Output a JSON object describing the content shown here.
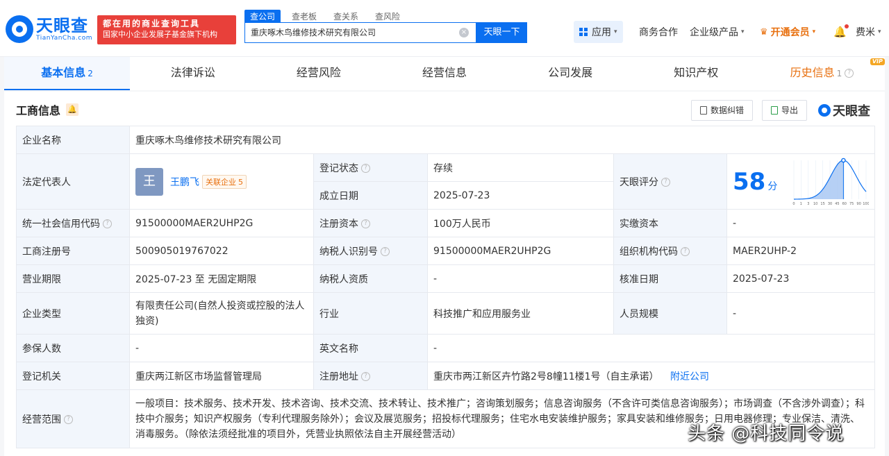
{
  "brand": {
    "name_cn": "天眼查",
    "name_en": "TianYanCha.com"
  },
  "slogan": {
    "line1": "都在用的商业查询工具",
    "line2": "国家中小企业发展子基金旗下机构"
  },
  "search": {
    "tabs": [
      "查公司",
      "查老板",
      "查关系",
      "查风险"
    ],
    "value": "重庆啄木鸟维修技术研究有限公司",
    "button": "天眼一下",
    "clear": "×"
  },
  "nav": {
    "apps": "应用",
    "business": "商务合作",
    "enterprise": "企业级产品",
    "vip": "开通会员",
    "user": "费米",
    "caret": "▾",
    "crown": "♛",
    "bell": "🔔"
  },
  "tabs": [
    {
      "label": "基本信息",
      "count": "2"
    },
    {
      "label": "法律诉讼"
    },
    {
      "label": "经营风险"
    },
    {
      "label": "经营信息"
    },
    {
      "label": "公司发展"
    },
    {
      "label": "知识产权"
    },
    {
      "label": "历史信息",
      "count": "1",
      "badge": "VIP"
    }
  ],
  "section": {
    "title": "工商信息",
    "bell": "🔔",
    "btn_correct": "数据纠错",
    "btn_export": "导出",
    "brand": "天眼查"
  },
  "info": {
    "company_name_label": "企业名称",
    "company_name": "重庆啄木鸟维修技术研究有限公司",
    "legal_rep_label": "法定代表人",
    "avatar": "王",
    "legal_rep": "王鹏飞",
    "assoc_label": "关联企业",
    "assoc_count": "5",
    "reg_status_label": "登记状态",
    "reg_status": "存续",
    "found_date_label": "成立日期",
    "found_date": "2025-07-23",
    "score_label": "天眼评分",
    "score": "58",
    "score_unit": "分",
    "credit_code_label": "统一社会信用代码",
    "credit_code": "91500000MAER2UHP2G",
    "reg_capital_label": "注册资本",
    "reg_capital": "100万人民币",
    "paid_capital_label": "实缴资本",
    "paid_capital": "-",
    "reg_no_label": "工商注册号",
    "reg_no": "500905019767022",
    "taxpayer_id_label": "纳税人识别号",
    "taxpayer_id": "91500000MAER2UHP2G",
    "org_code_label": "组织机构代码",
    "org_code": "MAER2UHP-2",
    "term_label": "营业期限",
    "term": "2025-07-23 至 无固定期限",
    "taxpayer_qual_label": "纳税人资质",
    "taxpayer_qual": "-",
    "approve_date_label": "核准日期",
    "approve_date": "2025-07-23",
    "type_label": "企业类型",
    "type": "有限责任公司(自然人投资或控股的法人独资)",
    "industry_label": "行业",
    "industry": "科技推广和应用服务业",
    "staff_label": "人员规模",
    "staff": "-",
    "insured_label": "参保人数",
    "insured": "-",
    "en_name_label": "英文名称",
    "en_name": "-",
    "authority_label": "登记机关",
    "authority": "重庆两江新区市场监督管理局",
    "address_label": "注册地址",
    "address": "重庆市两江新区卉竹路2号8幢11楼1号（自主承诺）",
    "nearby": "附近公司",
    "scope_label": "经营范围",
    "scope": "一般项目：技术服务、技术开发、技术咨询、技术交流、技术转让、技术推广；咨询策划服务；信息咨询服务（不含许可类信息咨询服务）；市场调查（不含涉外调查）；科技中介服务；知识产权服务（专利代理服务除外）；会议及展览服务；招投标代理服务；住宅水电安装维护服务；家具安装和维修服务；日用电器修理；专业保洁、清洗、消毒服务。（除依法须经批准的项目外，凭营业执照依法自主开展经营活动）"
  },
  "chart_data": {
    "type": "area",
    "x": [
      0,
      1,
      3,
      10,
      15,
      30,
      45,
      60,
      75,
      90,
      100
    ],
    "xticks": [
      "0",
      "1",
      "3",
      "10",
      "15",
      "30",
      "45",
      "60",
      "75",
      "90",
      "100"
    ],
    "marker_x": 58
  },
  "watermark": "头条 @科技同令说",
  "colors": {
    "accent": "#0a6ff0",
    "vip": "#e8700f",
    "status": "#2aa04a"
  }
}
